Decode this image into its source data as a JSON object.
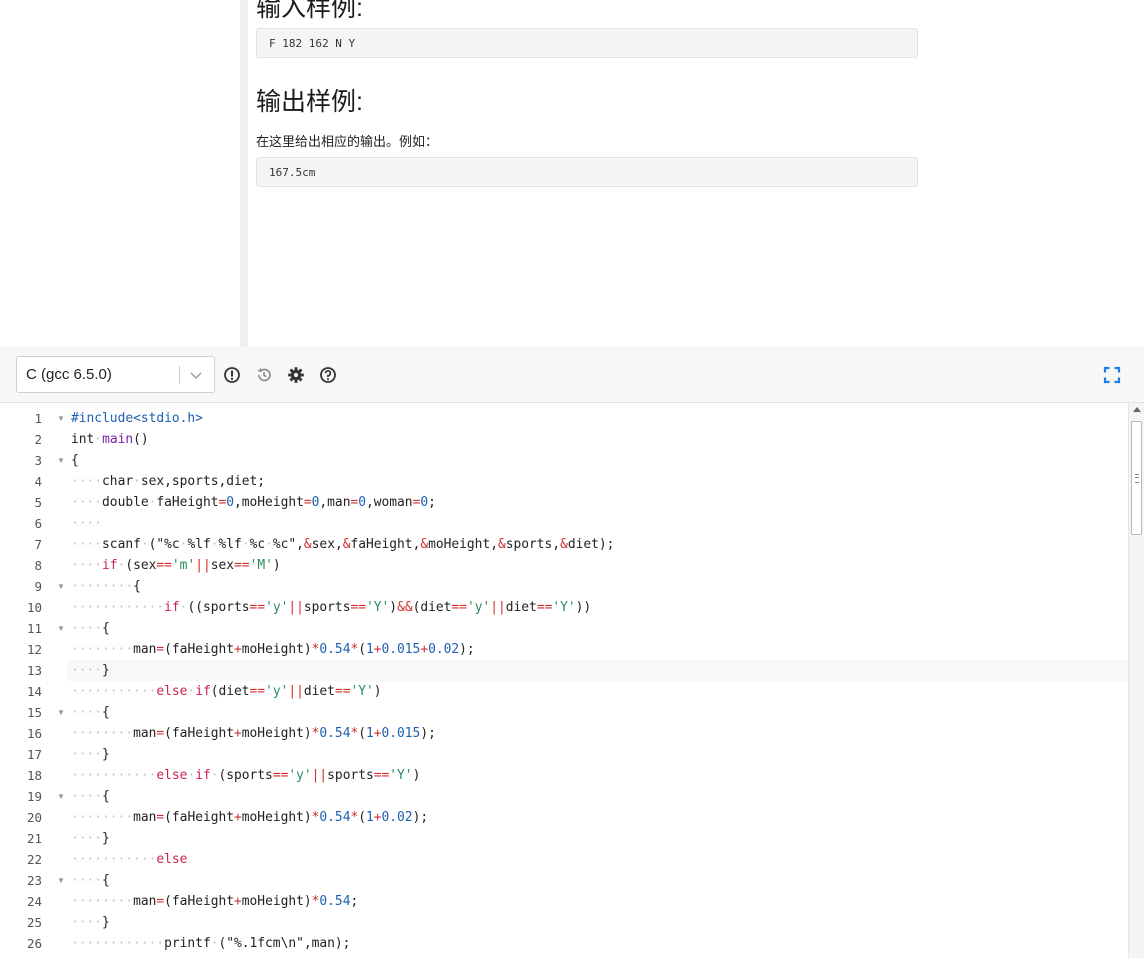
{
  "problem": {
    "input_heading": "输入样例:",
    "input_sample": "F 182 162 N Y",
    "output_heading": "输出样例:",
    "output_description": "在这里给出相应的输出。例如：",
    "output_sample": "167.5cm"
  },
  "toolbar": {
    "language": "C (gcc 6.5.0)",
    "icons": [
      "warning-icon",
      "history-icon",
      "gear-icon",
      "help-icon",
      "fullscreen-icon"
    ],
    "accent_color": "#1b7fe8"
  },
  "editor": {
    "colors": {
      "keyword": "#c7254e",
      "type": "#222222",
      "preproc": "#1d5fb0",
      "number": "#1d5fb0",
      "string": "#2a8a5a",
      "function": "#7d1fa8",
      "operator": "#d02d2d",
      "whitespace_dots": "#c4c4c4"
    },
    "active_line": 13,
    "lines": [
      {
        "num": "1",
        "fold": true,
        "tokens": [
          [
            "pp",
            "#include<stdio.h>"
          ]
        ]
      },
      {
        "num": "2",
        "fold": false,
        "tokens": [
          [
            "t",
            "int"
          ],
          [
            "ws",
            "·"
          ],
          [
            "fn",
            "main"
          ],
          [
            "p",
            "()"
          ]
        ]
      },
      {
        "num": "3",
        "fold": true,
        "tokens": [
          [
            "p",
            "{"
          ]
        ]
      },
      {
        "num": "4",
        "fold": false,
        "tokens": [
          [
            "ws",
            "····"
          ],
          [
            "t",
            "char"
          ],
          [
            "ws",
            "·"
          ],
          [
            "p",
            "sex,sports,diet;"
          ]
        ]
      },
      {
        "num": "5",
        "fold": false,
        "tokens": [
          [
            "ws",
            "····"
          ],
          [
            "t",
            "double"
          ],
          [
            "ws",
            "·"
          ],
          [
            "p",
            "faHeight"
          ],
          [
            "op",
            "="
          ],
          [
            "n",
            "0"
          ],
          [
            "p",
            ",moHeight"
          ],
          [
            "op",
            "="
          ],
          [
            "n",
            "0"
          ],
          [
            "p",
            ",man"
          ],
          [
            "op",
            "="
          ],
          [
            "n",
            "0"
          ],
          [
            "p",
            ",woman"
          ],
          [
            "op",
            "="
          ],
          [
            "n",
            "0"
          ],
          [
            "p",
            ";"
          ]
        ]
      },
      {
        "num": "6",
        "fold": false,
        "tokens": [
          [
            "ws",
            "····"
          ]
        ]
      },
      {
        "num": "7",
        "fold": false,
        "tokens": [
          [
            "ws",
            "····"
          ],
          [
            "p",
            "scanf"
          ],
          [
            "ws",
            "·"
          ],
          [
            "p",
            "(\"%c"
          ],
          [
            "ws",
            "·"
          ],
          [
            "p",
            "%lf"
          ],
          [
            "ws",
            "·"
          ],
          [
            "p",
            "%lf"
          ],
          [
            "ws",
            "·"
          ],
          [
            "p",
            "%c"
          ],
          [
            "ws",
            "·"
          ],
          [
            "p",
            "%c\","
          ],
          [
            "op",
            "&"
          ],
          [
            "p",
            "sex,"
          ],
          [
            "op",
            "&"
          ],
          [
            "p",
            "faHeight,"
          ],
          [
            "op",
            "&"
          ],
          [
            "p",
            "moHeight,"
          ],
          [
            "op",
            "&"
          ],
          [
            "p",
            "sports,"
          ],
          [
            "op",
            "&"
          ],
          [
            "p",
            "diet);"
          ]
        ]
      },
      {
        "num": "8",
        "fold": false,
        "tokens": [
          [
            "ws",
            "····"
          ],
          [
            "k",
            "if"
          ],
          [
            "ws",
            "·"
          ],
          [
            "p",
            "(sex"
          ],
          [
            "op",
            "=="
          ],
          [
            "s",
            "'m'"
          ],
          [
            "op",
            "||"
          ],
          [
            "p",
            "sex"
          ],
          [
            "op",
            "=="
          ],
          [
            "s",
            "'M'"
          ],
          [
            "p",
            ")"
          ]
        ]
      },
      {
        "num": "9",
        "fold": true,
        "tokens": [
          [
            "ws",
            "········"
          ],
          [
            "p",
            "{"
          ]
        ]
      },
      {
        "num": "10",
        "fold": false,
        "tokens": [
          [
            "ws",
            "············"
          ],
          [
            "k",
            "if"
          ],
          [
            "ws",
            "·"
          ],
          [
            "p",
            "((sports"
          ],
          [
            "op",
            "=="
          ],
          [
            "s",
            "'y'"
          ],
          [
            "op",
            "||"
          ],
          [
            "p",
            "sports"
          ],
          [
            "op",
            "=="
          ],
          [
            "s",
            "'Y'"
          ],
          [
            "p",
            ")"
          ],
          [
            "op",
            "&&"
          ],
          [
            "p",
            "(diet"
          ],
          [
            "op",
            "=="
          ],
          [
            "s",
            "'y'"
          ],
          [
            "op",
            "||"
          ],
          [
            "p",
            "diet"
          ],
          [
            "op",
            "=="
          ],
          [
            "s",
            "'Y'"
          ],
          [
            "p",
            "))"
          ]
        ]
      },
      {
        "num": "11",
        "fold": true,
        "tokens": [
          [
            "ws",
            "····"
          ],
          [
            "p",
            "{"
          ]
        ]
      },
      {
        "num": "12",
        "fold": false,
        "tokens": [
          [
            "ws",
            "········"
          ],
          [
            "p",
            "man"
          ],
          [
            "op",
            "="
          ],
          [
            "p",
            "(faHeight"
          ],
          [
            "op",
            "+"
          ],
          [
            "p",
            "moHeight)"
          ],
          [
            "op",
            "*"
          ],
          [
            "n",
            "0.54"
          ],
          [
            "op",
            "*"
          ],
          [
            "p",
            "("
          ],
          [
            "n",
            "1"
          ],
          [
            "op",
            "+"
          ],
          [
            "n",
            "0.015"
          ],
          [
            "op",
            "+"
          ],
          [
            "n",
            "0.02"
          ],
          [
            "p",
            ");"
          ]
        ]
      },
      {
        "num": "13",
        "fold": false,
        "tokens": [
          [
            "ws",
            "····"
          ],
          [
            "p",
            "}"
          ]
        ]
      },
      {
        "num": "14",
        "fold": false,
        "tokens": [
          [
            "ws",
            "···········"
          ],
          [
            "k",
            "else"
          ],
          [
            "ws",
            "·"
          ],
          [
            "k",
            "if"
          ],
          [
            "p",
            "(diet"
          ],
          [
            "op",
            "=="
          ],
          [
            "s",
            "'y'"
          ],
          [
            "op",
            "||"
          ],
          [
            "p",
            "diet"
          ],
          [
            "op",
            "=="
          ],
          [
            "s",
            "'Y'"
          ],
          [
            "p",
            ")"
          ]
        ]
      },
      {
        "num": "15",
        "fold": true,
        "tokens": [
          [
            "ws",
            "····"
          ],
          [
            "p",
            "{"
          ]
        ]
      },
      {
        "num": "16",
        "fold": false,
        "tokens": [
          [
            "ws",
            "········"
          ],
          [
            "p",
            "man"
          ],
          [
            "op",
            "="
          ],
          [
            "p",
            "(faHeight"
          ],
          [
            "op",
            "+"
          ],
          [
            "p",
            "moHeight)"
          ],
          [
            "op",
            "*"
          ],
          [
            "n",
            "0.54"
          ],
          [
            "op",
            "*"
          ],
          [
            "p",
            "("
          ],
          [
            "n",
            "1"
          ],
          [
            "op",
            "+"
          ],
          [
            "n",
            "0.015"
          ],
          [
            "p",
            ");"
          ]
        ]
      },
      {
        "num": "17",
        "fold": false,
        "tokens": [
          [
            "ws",
            "····"
          ],
          [
            "p",
            "}"
          ]
        ]
      },
      {
        "num": "18",
        "fold": false,
        "tokens": [
          [
            "ws",
            "···········"
          ],
          [
            "k",
            "else"
          ],
          [
            "ws",
            "·"
          ],
          [
            "k",
            "if"
          ],
          [
            "ws",
            "·"
          ],
          [
            "p",
            "(sports"
          ],
          [
            "op",
            "=="
          ],
          [
            "s",
            "'y'"
          ],
          [
            "op",
            "||"
          ],
          [
            "p",
            "sports"
          ],
          [
            "op",
            "=="
          ],
          [
            "s",
            "'Y'"
          ],
          [
            "p",
            ")"
          ]
        ]
      },
      {
        "num": "19",
        "fold": true,
        "tokens": [
          [
            "ws",
            "····"
          ],
          [
            "p",
            "{"
          ]
        ]
      },
      {
        "num": "20",
        "fold": false,
        "tokens": [
          [
            "ws",
            "········"
          ],
          [
            "p",
            "man"
          ],
          [
            "op",
            "="
          ],
          [
            "p",
            "(faHeight"
          ],
          [
            "op",
            "+"
          ],
          [
            "p",
            "moHeight)"
          ],
          [
            "op",
            "*"
          ],
          [
            "n",
            "0.54"
          ],
          [
            "op",
            "*"
          ],
          [
            "p",
            "("
          ],
          [
            "n",
            "1"
          ],
          [
            "op",
            "+"
          ],
          [
            "n",
            "0.02"
          ],
          [
            "p",
            ");"
          ]
        ]
      },
      {
        "num": "21",
        "fold": false,
        "tokens": [
          [
            "ws",
            "····"
          ],
          [
            "p",
            "}"
          ]
        ]
      },
      {
        "num": "22",
        "fold": false,
        "tokens": [
          [
            "ws",
            "···········"
          ],
          [
            "k",
            "else"
          ]
        ]
      },
      {
        "num": "23",
        "fold": true,
        "tokens": [
          [
            "ws",
            "····"
          ],
          [
            "p",
            "{"
          ]
        ]
      },
      {
        "num": "24",
        "fold": false,
        "tokens": [
          [
            "ws",
            "········"
          ],
          [
            "p",
            "man"
          ],
          [
            "op",
            "="
          ],
          [
            "p",
            "(faHeight"
          ],
          [
            "op",
            "+"
          ],
          [
            "p",
            "moHeight)"
          ],
          [
            "op",
            "*"
          ],
          [
            "n",
            "0.54"
          ],
          [
            "p",
            ";"
          ]
        ]
      },
      {
        "num": "25",
        "fold": false,
        "tokens": [
          [
            "ws",
            "····"
          ],
          [
            "p",
            "}"
          ]
        ]
      },
      {
        "num": "26",
        "fold": false,
        "tokens": [
          [
            "ws",
            "············"
          ],
          [
            "p",
            "printf"
          ],
          [
            "ws",
            "·"
          ],
          [
            "p",
            "(\"%.1fcm\\n\",man);"
          ]
        ]
      }
    ]
  }
}
